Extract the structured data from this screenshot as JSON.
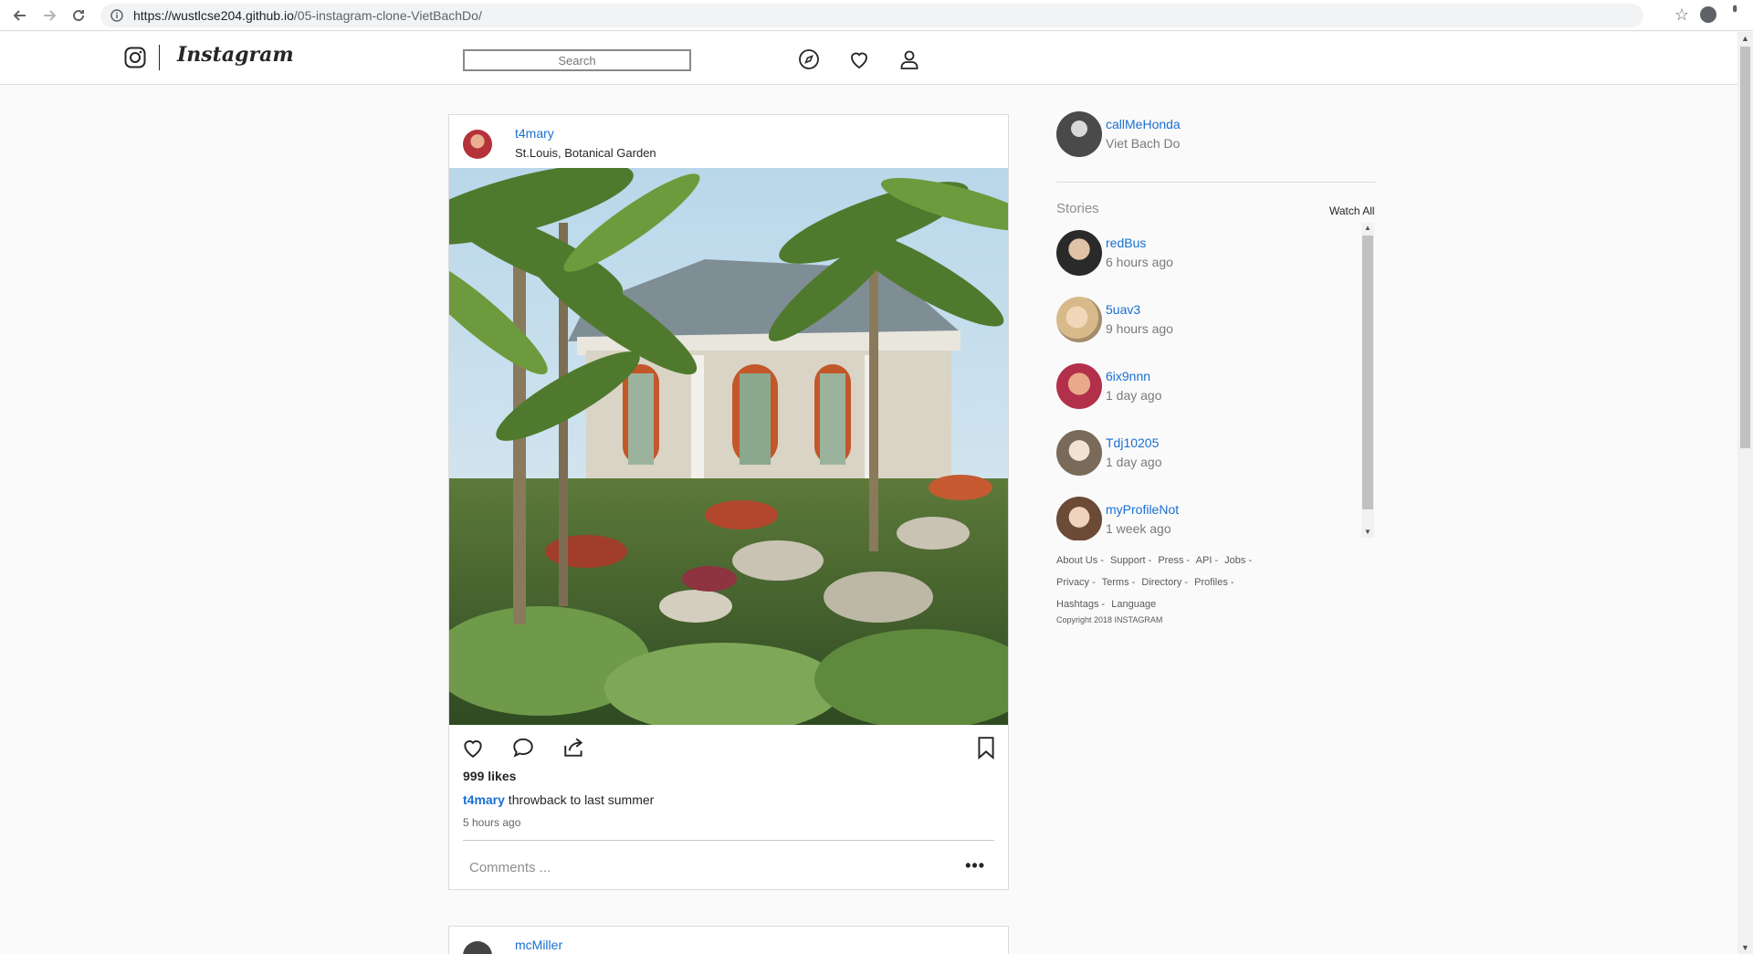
{
  "browser": {
    "url_host": "https://wustlcse204.github.io",
    "url_path": "/05-instagram-clone-VietBachDo/",
    "back_icon": "arrow-left-icon",
    "forward_icon": "arrow-right-icon",
    "reload_icon": "reload-icon"
  },
  "header": {
    "wordmark": "Instagram",
    "search_placeholder": "Search",
    "icons": [
      "compass-icon",
      "heart-icon",
      "user-icon"
    ]
  },
  "post": {
    "username": "t4mary",
    "location": "St.Louis, Botanical Garden",
    "likes": "999 likes",
    "caption_user": "t4mary",
    "caption_text": " throwback to last summer",
    "time": "5 hours ago",
    "comments_placeholder": "Comments ...",
    "more": "•••"
  },
  "next_post": {
    "username": "mcMiller"
  },
  "profile": {
    "username": "callMeHonda",
    "name": "Viet Bach Do"
  },
  "stories": {
    "title": "Stories",
    "watch_all": "Watch All",
    "items": [
      {
        "user": "redBus",
        "time": "6 hours ago"
      },
      {
        "user": "5uav3",
        "time": "9 hours ago"
      },
      {
        "user": "6ix9nnn",
        "time": "1 day ago"
      },
      {
        "user": "Tdj10205",
        "time": "1 day ago"
      },
      {
        "user": "myProfileNot",
        "time": "1 week ago"
      }
    ]
  },
  "footer": {
    "links": [
      "About Us -",
      "Support -",
      "Press -",
      "API -",
      "Jobs -",
      "Privacy -",
      "Terms -",
      "Directory -",
      "Profiles -",
      "Hashtags -",
      "Language"
    ],
    "copyright": "Copyright 2018 INSTAGRAM"
  },
  "colors": {
    "link": "#1a6fd1",
    "background": "#fafafa",
    "border": "#dbdbdb"
  }
}
